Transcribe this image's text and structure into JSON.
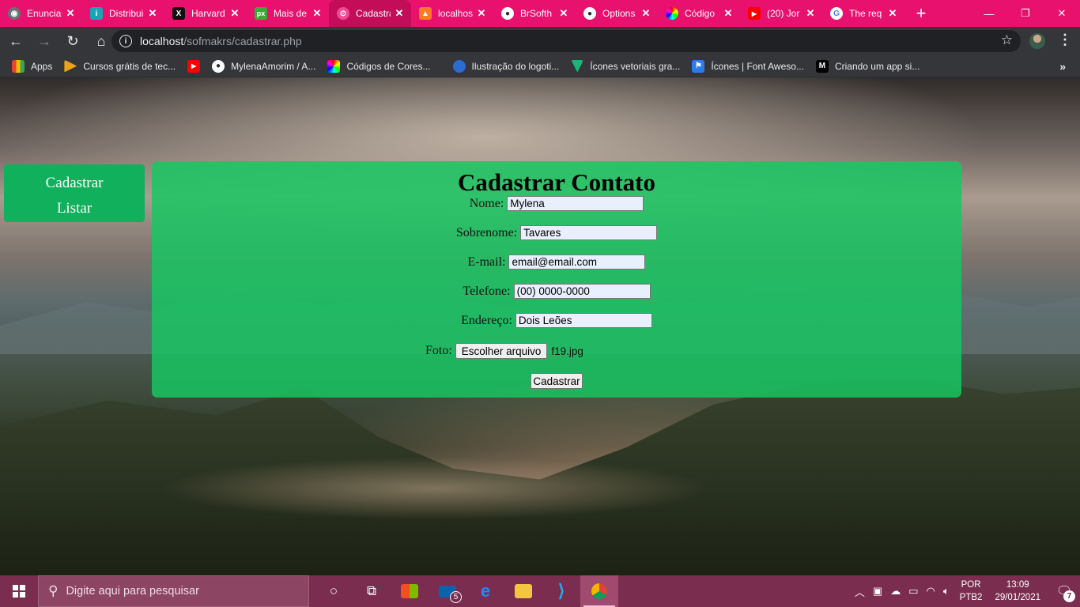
{
  "browser": {
    "tabs": [
      {
        "title": "Enunciado",
        "icon": "globe-icon",
        "color": "#5f6368"
      },
      {
        "title": "Distribuição",
        "icon": "distrib-icon",
        "color": "#16a6b6"
      },
      {
        "title": "Harvard",
        "icon": "x-logo-icon",
        "color": "#111111"
      },
      {
        "title": "Mais de",
        "icon": "px-icon",
        "color": "#3aaa35"
      },
      {
        "title": "Cadastrar",
        "icon": "local-icon",
        "color": "#e8116e"
      },
      {
        "title": "localhost",
        "icon": "xampp-icon",
        "color": "#fb7a24"
      },
      {
        "title": "BrSofth",
        "icon": "github-icon",
        "color": "#24292e"
      },
      {
        "title": "Options",
        "icon": "github-icon",
        "color": "#24292e"
      },
      {
        "title": "Código",
        "icon": "color-wheel-icon",
        "color": "#ffffff"
      },
      {
        "title": "(20) Jor",
        "icon": "youtube-icon",
        "color": "#ff0000"
      },
      {
        "title": "The req",
        "icon": "google-icon",
        "color": "#ffffff"
      }
    ],
    "url_host": "localhost",
    "url_path": "/sofmakrs/cadastrar.php",
    "bookmarks": [
      {
        "label": "Apps",
        "icon": "apps-grid-icon"
      },
      {
        "label": "Cursos grátis de tec...",
        "icon": "cursos-icon"
      },
      {
        "label": "",
        "icon": "youtube-icon"
      },
      {
        "label": "MylenaAmorim / A...",
        "icon": "github-icon"
      },
      {
        "label": "Códigos de Cores...",
        "icon": "color-wheel-icon"
      },
      {
        "label": "Ilustração do logoti...",
        "icon": "logo-icon"
      },
      {
        "label": "Ícones vetoriais gra...",
        "icon": "vector-icon"
      },
      {
        "label": "Ícones | Font Aweso...",
        "icon": "flag-icon"
      },
      {
        "label": "Criando um app si...",
        "icon": "medium-icon"
      }
    ]
  },
  "sidemenu": {
    "items": [
      "Cadastrar",
      "Listar"
    ]
  },
  "form": {
    "title": "Cadastrar Contato",
    "fields": [
      {
        "label": "Nome:",
        "value": "Mylena"
      },
      {
        "label": "Sobrenome:",
        "value": "Tavares"
      },
      {
        "label": "E-mail:",
        "value": "email@email.com"
      },
      {
        "label": "Telefone:",
        "value": "(00) 0000-0000"
      },
      {
        "label": "Endereço:",
        "value": "Dois Leões"
      }
    ],
    "photo_label": "Foto:",
    "file_button": "Escolher arquivo",
    "file_name": "f19.jpg",
    "submit": "Cadastrar"
  },
  "taskbar": {
    "search_placeholder": "Digite aqui para pesquisar",
    "mail_badge": "5",
    "lang_top": "POR",
    "lang_bottom": "PTB2",
    "time": "13:09",
    "date": "29/01/2021",
    "notification_count": "7"
  },
  "colors": {
    "tabstrip": "#e8116e",
    "form_bg": "#17c762",
    "menu_bg": "#10b05c",
    "taskbar": "#7a2d4e"
  }
}
